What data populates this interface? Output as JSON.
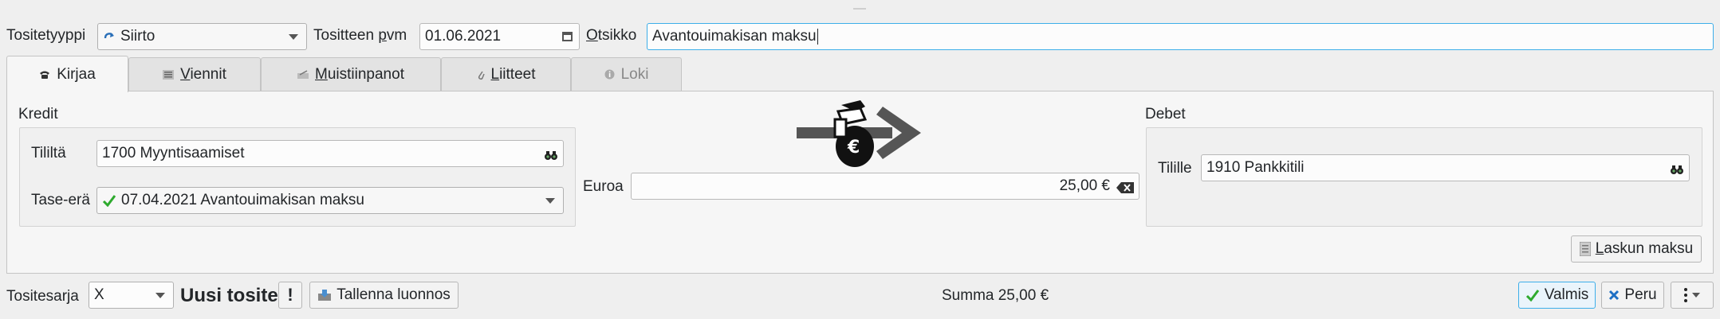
{
  "header": {
    "type_label": "Tositetyyppi",
    "type_value": "Siirto",
    "date_label_pre": "Tositteen ",
    "date_label_ul": "p",
    "date_label_post": "vm",
    "date_value": "01.06.2021",
    "title_label_ul": "O",
    "title_label_post": "tsikko",
    "title_value": "Avantouimakisan maksu"
  },
  "tabs": [
    {
      "label": "Kirjaa",
      "ul": "",
      "icon": "phone-icon"
    },
    {
      "label": "iennit",
      "ul": "V",
      "icon": "list-icon"
    },
    {
      "label": "uistiinpanot",
      "ul": "M",
      "icon": "notes-icon"
    },
    {
      "label": "iitteet",
      "ul": "L",
      "icon": "paperclip-icon"
    },
    {
      "label": "Loki",
      "ul": "",
      "icon": "info-icon"
    }
  ],
  "kredit": {
    "title": "Kredit",
    "account_label": "Tililtä",
    "account_value": "1700 Myyntisaamiset",
    "balance_label": "Tase-erä",
    "balance_value": "07.04.2021 Avantouimakisan maksu"
  },
  "amount": {
    "label": "Euroa",
    "value": "25,00 €"
  },
  "debet": {
    "title": "Debet",
    "account_label": "Tilille",
    "account_value": "1910 Pankkitili"
  },
  "invoice_button": {
    "ul": "L",
    "label": "askun maksu"
  },
  "footer": {
    "series_label": "Tositesarja",
    "series_value": "X",
    "new_doc": "Uusi tosite",
    "save_draft": "Tallenna luonnos",
    "sum": "Summa 25,00 €",
    "ok": "Valmis",
    "cancel": "Peru"
  },
  "colors": {
    "accent": "#3daee9",
    "check_green": "#2eaa2e",
    "cancel_blue": "#1d6fc4"
  }
}
